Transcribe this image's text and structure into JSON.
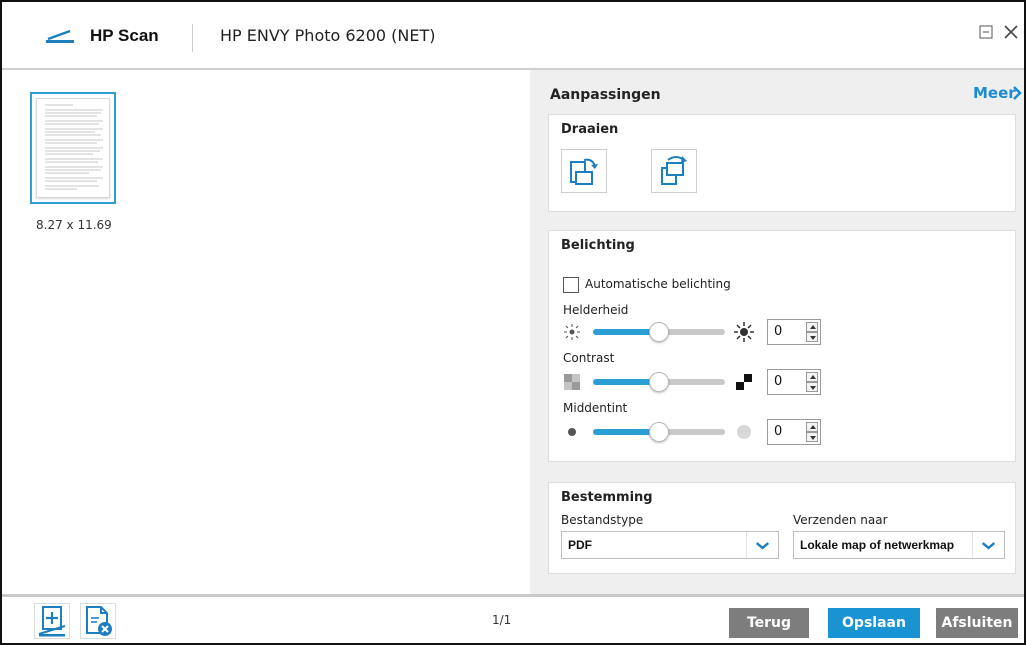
{
  "titlebar": {
    "app_name": "HP Scan",
    "device_name": "HP ENVY Photo 6200 (NET)"
  },
  "preview": {
    "thumbnail_size": "8.27 x 11.69",
    "page_count": "1/1"
  },
  "adjustments": {
    "title": "Aanpassingen",
    "more_label": "Meer",
    "rotate": {
      "title": "Draaien"
    },
    "exposure": {
      "title": "Belichting",
      "auto_label": "Automatische belichting",
      "auto_checked": false,
      "sliders": [
        {
          "label": "Helderheid",
          "value": "0",
          "level": 0.5
        },
        {
          "label": "Contrast",
          "value": "0",
          "level": 0.5
        },
        {
          "label": "Middentint",
          "value": "0",
          "level": 0.5
        }
      ]
    },
    "destination": {
      "title": "Bestemming",
      "filetype_label": "Bestandstype",
      "filetype_value": "PDF",
      "sendto_label": "Verzenden naar",
      "sendto_value": "Lokale map of netwerkmap"
    }
  },
  "footer": {
    "back_label": "Terug",
    "save_label": "Opslaan",
    "close_label": "Afsluiten"
  },
  "colors": {
    "accent": "#1a93d3",
    "slider_fill": "#2a9fd6",
    "button_gray": "#7d7d7d"
  }
}
